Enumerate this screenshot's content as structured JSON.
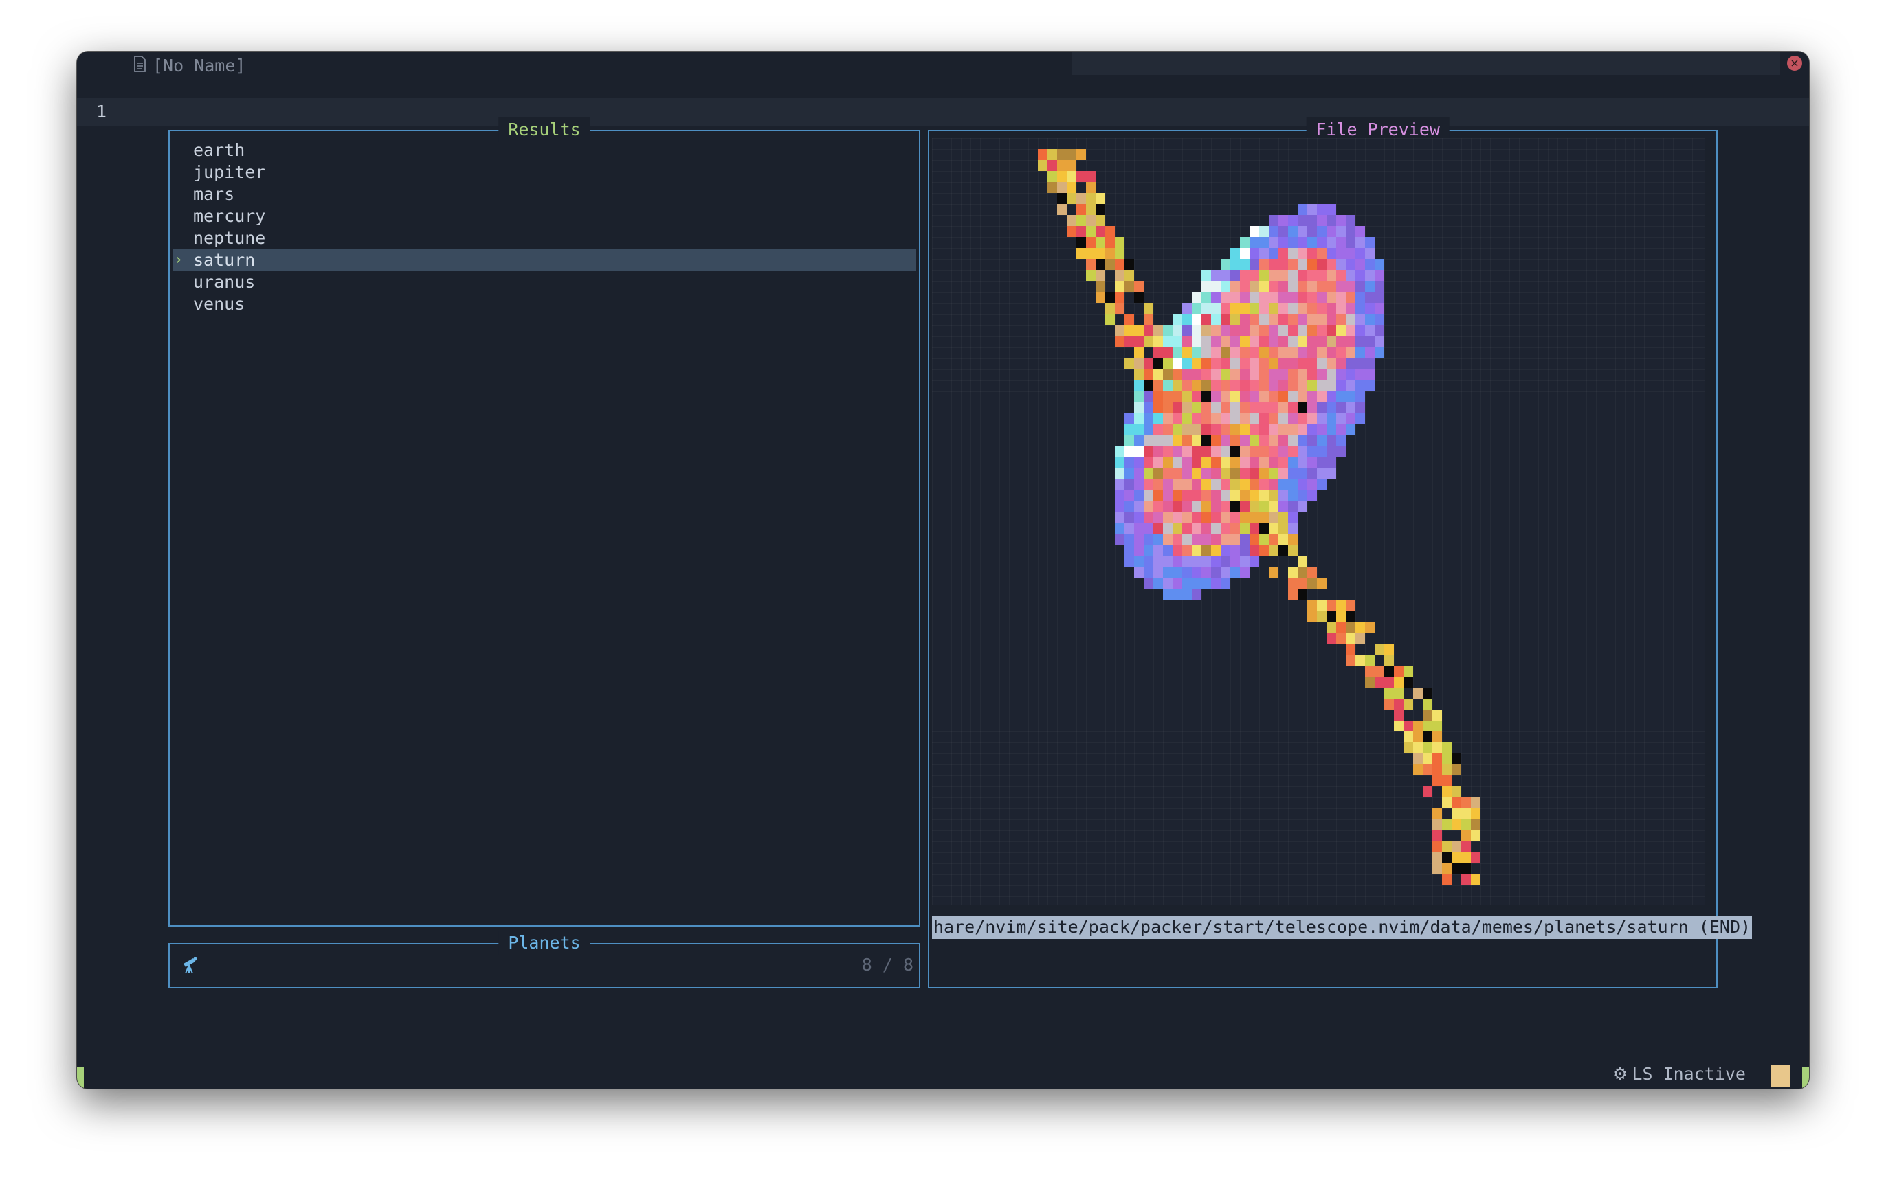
{
  "tab": {
    "title": "[No Name]"
  },
  "editor": {
    "line_number": "1"
  },
  "results": {
    "title": "Results",
    "title_color": "#a7d17a",
    "items": [
      {
        "label": "earth",
        "selected": false
      },
      {
        "label": "jupiter",
        "selected": false
      },
      {
        "label": "mars",
        "selected": false
      },
      {
        "label": "mercury",
        "selected": false
      },
      {
        "label": "neptune",
        "selected": false
      },
      {
        "label": "saturn",
        "selected": true
      },
      {
        "label": "uranus",
        "selected": false
      },
      {
        "label": "venus",
        "selected": false
      }
    ],
    "selection_caret": "›"
  },
  "prompt": {
    "title": "Planets",
    "title_color": "#6cb6e8",
    "count": "8 / 8",
    "icon": "telescope-icon",
    "value": ""
  },
  "preview": {
    "title": "File Preview",
    "title_color": "#d68fe0",
    "image": "saturn-pixel-art",
    "path": "hare/nvim/site/pack/packer/start/telescope.nvim/data/memes/planets/saturn (END)"
  },
  "statusbar": {
    "ls_status": "LS Inactive",
    "ls_icon": "gear-icon",
    "accent": "#a7d17a",
    "block_color": "#e8c78b"
  }
}
